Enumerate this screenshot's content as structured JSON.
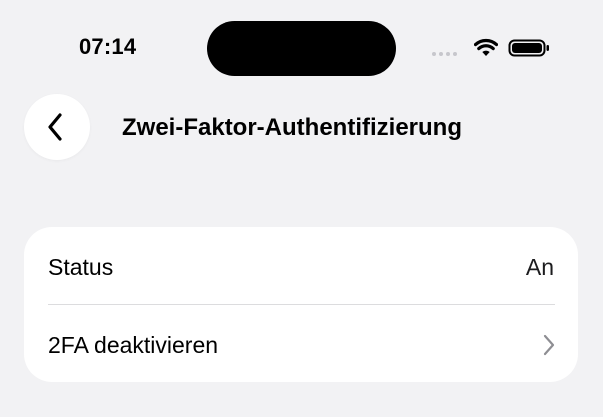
{
  "status_bar": {
    "time": "07:14",
    "icons": [
      "signal-icon",
      "wifi-icon",
      "battery-icon"
    ]
  },
  "nav": {
    "back_icon": "chevron-left-icon",
    "title": "Zwei-Faktor-Authentifizierung"
  },
  "settings": {
    "rows": [
      {
        "label": "Status",
        "value": "An"
      },
      {
        "label": "2FA deaktivieren",
        "icon": "chevron-right-icon"
      }
    ]
  },
  "colors": {
    "background": "#f2f2f4",
    "card": "#ffffff",
    "divider": "#dcdcde",
    "chevron": "#8e8e93"
  }
}
